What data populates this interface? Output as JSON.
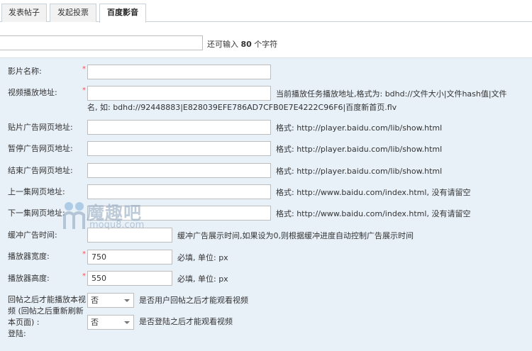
{
  "tabs": [
    {
      "label": "发表帖子"
    },
    {
      "label": "发起投票"
    },
    {
      "label": "百度影音"
    }
  ],
  "title_hint": {
    "prefix": "还可输入 ",
    "count": "80",
    "suffix": " 个字符"
  },
  "form": {
    "movie_name": {
      "label": "影片名称:",
      "required": "*",
      "value": ""
    },
    "video_url": {
      "label": "视频播放地址:",
      "required": "*",
      "value": "",
      "note_line1": "当前播放任务播放地址,格式为: bdhd://文件大小|文件hash值|文件",
      "note_line2": "名, 如: bdhd://92448883|E828039EFE786AD7CFB0E7E4222C96F6|百度新首页.flv"
    },
    "patch_ad_url": {
      "label": "贴片广告网页地址:",
      "value": "",
      "note": "格式: http://player.baidu.com/lib/show.html"
    },
    "pause_ad_url": {
      "label": "暂停广告网页地址:",
      "value": "",
      "note": "格式: http://player.baidu.com/lib/show.html"
    },
    "end_ad_url": {
      "label": "结束广告网页地址:",
      "value": "",
      "note": "格式: http://player.baidu.com/lib/show.html"
    },
    "prev_url": {
      "label": "上一集网页地址:",
      "value": "",
      "note": "格式: http://www.baidu.com/index.html, 没有请留空"
    },
    "next_url": {
      "label": "下一集网页地址:",
      "value": "",
      "note": "格式: http://www.baidu.com/index.html, 没有请留空"
    },
    "buffer_ad_time": {
      "label": "缓冲广告时间:",
      "value": "",
      "note": "缓冲广告展示时间,如果设为0,则根据缓冲进度自动控制广告展示时间"
    },
    "player_width": {
      "label": "播放器宽度:",
      "required": "*",
      "value": "750",
      "note": "必填, 单位: px"
    },
    "player_height": {
      "label": "播放器高度:",
      "required": "*",
      "value": "550",
      "note": "必填, 单位: px"
    },
    "reply_to_view": {
      "label_line1": "回帖之后才能播放本视",
      "label_line2": "频 (回帖之后重新刷新",
      "label_line3": "本页面) :",
      "selected": "否",
      "note": "是否用户回帖之后才能观看视频"
    },
    "login_to_view": {
      "label": "登陆:",
      "selected": "否",
      "note": "是否登陆之后才能观看视频"
    }
  },
  "watermark": {
    "text_cn": "魔趣吧",
    "text_en": "moqu8.com",
    "logo": "moqu8-logo-icon"
  },
  "colors": {
    "panel_bg": "#e8f0f8",
    "required": "#ee5555",
    "border": "#bdbdbd"
  }
}
